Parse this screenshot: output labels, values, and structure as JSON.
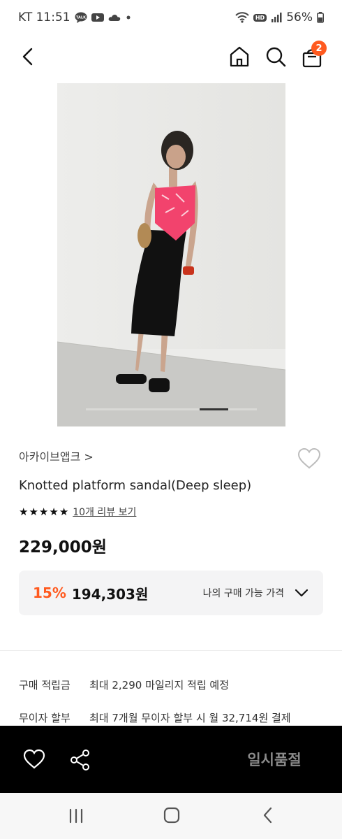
{
  "status_bar": {
    "carrier_time": "KT 11:51",
    "battery": "56%",
    "talk_label": "TALK",
    "hd_label": "HD",
    "icons": [
      "talk-icon",
      "youtube-icon",
      "cloud-icon",
      "dot-icon",
      "wifi-icon",
      "hd-icon",
      "signal-icon",
      "battery-icon"
    ]
  },
  "nav": {
    "icons": [
      "back-icon",
      "home-icon",
      "search-icon",
      "cart-icon"
    ],
    "cart_count": "2"
  },
  "product": {
    "brand": "아카이브앱크 >",
    "title": "Knotted platform sandal(Deep sleep)",
    "review_link": "10개 리뷰 보기",
    "rating_stars": 5,
    "price": "229,000원",
    "discount_percent": "15%",
    "discount_price": "194,303원",
    "my_price_label": "나의 구매 가능 가격",
    "image_slide": 4,
    "image_slides_total": 6
  },
  "benefits": [
    {
      "label": "구매 적립금",
      "value": "최대 2,290 마일리지 적립 예정"
    },
    {
      "label": "무이자 할부",
      "value": "최대 7개월 무이자 할부 시 월 32,714원 결제"
    }
  ],
  "action_bar": {
    "button_label": "일시품절",
    "icons": [
      "heart-icon",
      "share-icon"
    ]
  },
  "system_nav": {
    "icons": [
      "recent-apps-icon",
      "home-button-icon",
      "back-button-icon"
    ]
  },
  "colors": {
    "accent": "#ff5a1f",
    "action_bar": "#000000",
    "price_box": "#f4f4f5"
  }
}
